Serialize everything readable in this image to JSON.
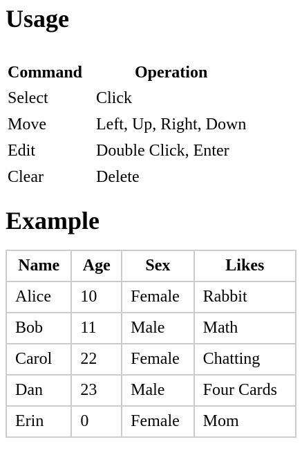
{
  "usage": {
    "heading": "Usage",
    "headers": [
      "Command",
      "Operation"
    ],
    "rows": [
      [
        "Select",
        "Click"
      ],
      [
        "Move",
        "Left, Up, Right, Down"
      ],
      [
        "Edit",
        "Double Click, Enter"
      ],
      [
        "Clear",
        "Delete"
      ]
    ]
  },
  "example": {
    "heading": "Example",
    "headers": [
      "Name",
      "Age",
      "Sex",
      "Likes"
    ],
    "rows": [
      [
        "Alice",
        "10",
        "Female",
        "Rabbit"
      ],
      [
        "Bob",
        "11",
        "Male",
        "Math"
      ],
      [
        "Carol",
        "22",
        "Female",
        "Chatting"
      ],
      [
        "Dan",
        "23",
        "Male",
        "Four Cards"
      ],
      [
        "Erin",
        "0",
        "Female",
        "Mom"
      ]
    ]
  }
}
